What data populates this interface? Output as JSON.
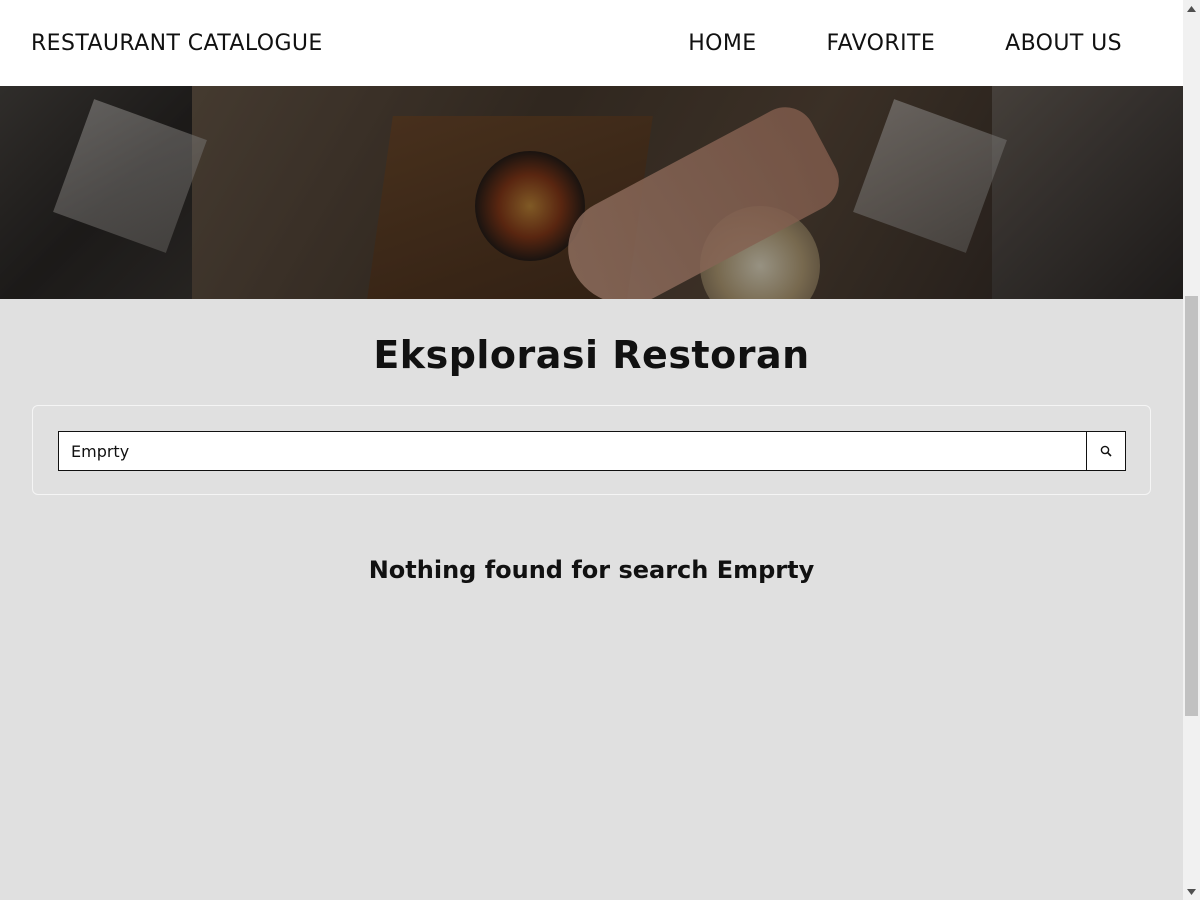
{
  "header": {
    "brand": "RESTAURANT CATALOGUE",
    "nav": [
      {
        "label": "HOME"
      },
      {
        "label": "FAVORITE"
      },
      {
        "label": "ABOUT US"
      }
    ]
  },
  "main": {
    "title": "Eksplorasi Restoran",
    "search": {
      "value": "Emprty",
      "button_icon": "search-icon"
    },
    "empty_message": "Nothing found for search Emprty"
  },
  "colors": {
    "background": "#e0e0e0",
    "header_bg": "#ffffff",
    "text": "#111111"
  }
}
